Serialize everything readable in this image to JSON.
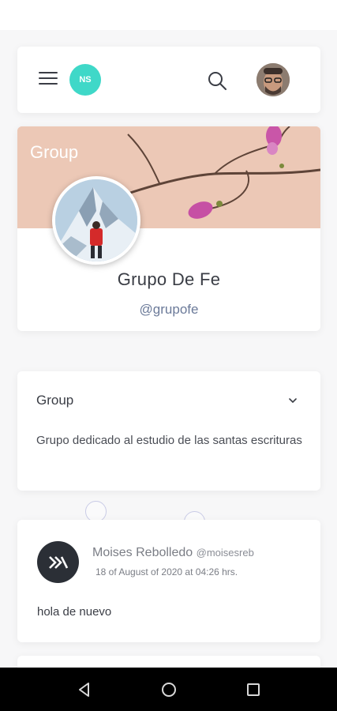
{
  "header": {
    "badge_initials": "NS"
  },
  "cover": {
    "label": "Group",
    "group_name": "Grupo De Fe",
    "group_handle": "@grupofe"
  },
  "info": {
    "title": "Group",
    "description": "Grupo dedicado al estudio de las santas escrituras"
  },
  "post": {
    "author": "Moises Rebolledo",
    "handle": "@moisesreb",
    "date": "18 of August of 2020 at 04:26 hrs.",
    "text": "hola de nuevo"
  },
  "colors": {
    "accent": "#3fd8c8",
    "cover_bg": "#ecc8b6",
    "handle_color": "#6b7a99"
  },
  "icons": [
    "menu-icon",
    "search-icon",
    "chevron-down-icon",
    "back-icon",
    "home-icon",
    "recents-icon"
  ]
}
